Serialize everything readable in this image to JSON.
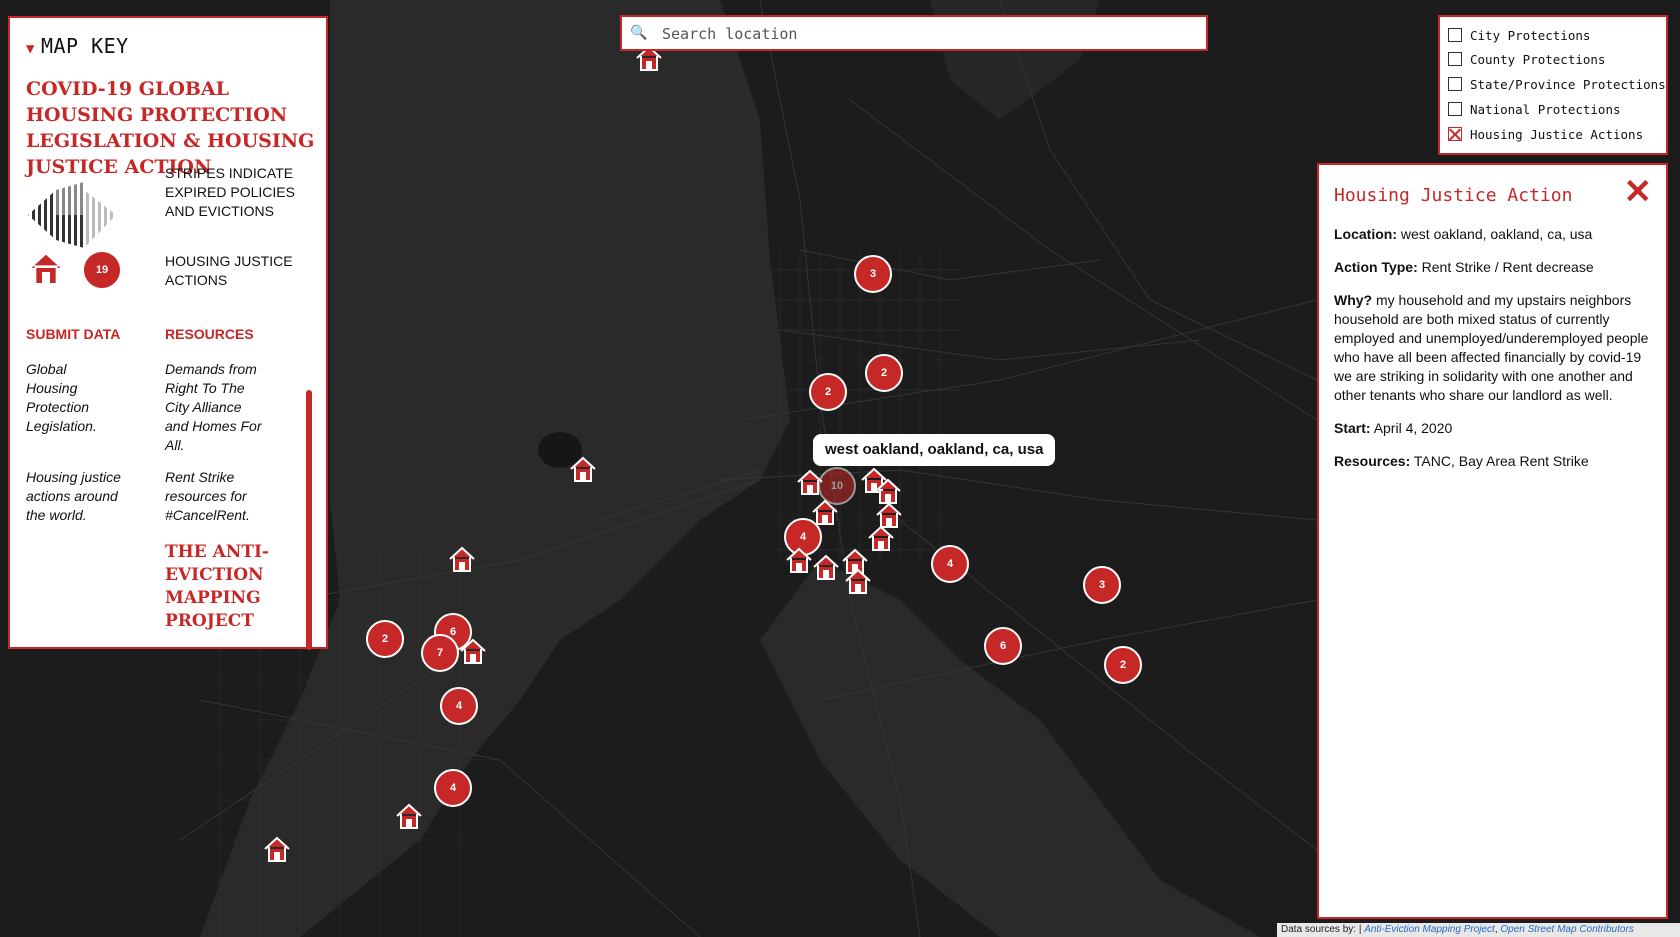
{
  "search": {
    "placeholder": "Search location"
  },
  "map_key": {
    "header": "MAP KEY",
    "title": "COVID-19 GLOBAL HOUSING PROTECTION LEGISLATION & HOUSING JUSTICE ACTION",
    "legend": [
      {
        "text": "STRIPES INDICATE EXPIRED POLICIES AND EVICTIONS"
      },
      {
        "count": "19",
        "text": "HOUSING JUSTICE ACTIONS"
      }
    ],
    "submit_data": {
      "heading": "SUBMIT DATA",
      "items": [
        "Global Housing Protection Legislation.",
        "Housing justice actions around the world."
      ]
    },
    "resources": {
      "heading": "RESOURCES",
      "items": [
        "Demands from Right To The City Alliance and Homes For All.",
        "Rent Strike resources for #CancelRent."
      ]
    },
    "project_name": "THE ANTI-EVICTION MAPPING PROJECT"
  },
  "filters": [
    {
      "label": "City Protections",
      "checked": false
    },
    {
      "label": "County Protections",
      "checked": false
    },
    {
      "label": "State/Province Protections",
      "checked": false
    },
    {
      "label": "National Protections",
      "checked": false
    },
    {
      "label": "Housing Justice Actions",
      "checked": true
    }
  ],
  "detail": {
    "title": "Housing Justice Action",
    "close": "✕",
    "fields": [
      {
        "label": "Location:",
        "value": "west oakland, oakland, ca, usa"
      },
      {
        "label": "Action Type:",
        "value": "Rent Strike / Rent decrease"
      },
      {
        "label": "Why?",
        "value": "my household and my upstairs neighbors household are both mixed status of currently employed and unemployed/underemployed people who have all been affected financially by covid-19 we are striking in solidarity with one another and other tenants who share our landlord as well."
      },
      {
        "label": "Start:",
        "value": "April 4, 2020"
      },
      {
        "label": "Resources:",
        "value": "TANC, Bay Area Rent Strike"
      }
    ]
  },
  "tooltip": "west oakland, oakland, ca, usa",
  "clusters": [
    "3",
    "2",
    "2",
    "10",
    "4",
    "4",
    "3",
    "6",
    "2",
    "2",
    "6",
    "7",
    "4",
    "4"
  ],
  "attribution": {
    "prefix": "Data sources by: |",
    "links": [
      "Anti-Eviction Mapping Project",
      "Open Street Map Contributors"
    ]
  },
  "colors": {
    "accent": "#c62828",
    "map_bg": "#1c1c1c",
    "water": "#2b2b2b",
    "roads": "#3a3a3a"
  }
}
